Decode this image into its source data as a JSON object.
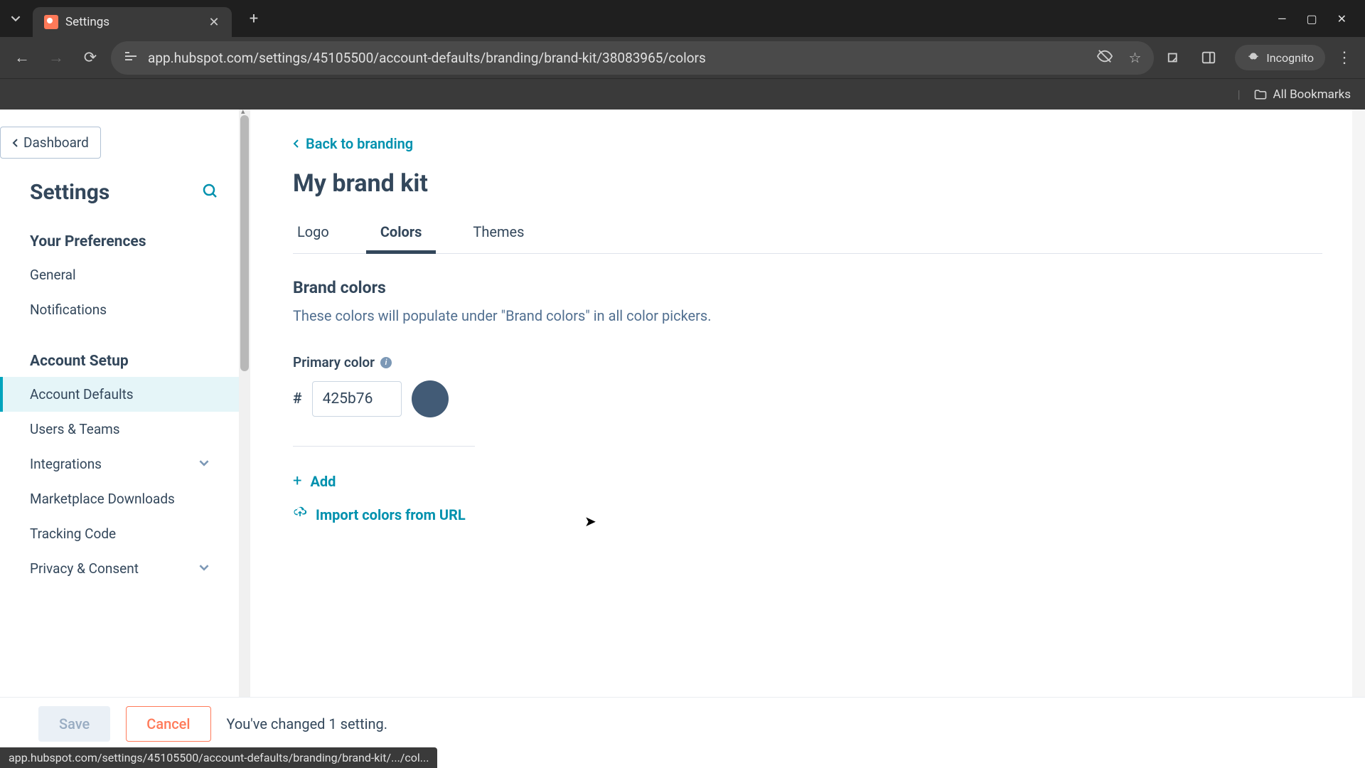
{
  "browser": {
    "tab_title": "Settings",
    "url": "app.hubspot.com/settings/45105500/account-defaults/branding/brand-kit/38083965/colors",
    "incognito_label": "Incognito",
    "bookmarks_label": "All Bookmarks",
    "status_url": "app.hubspot.com/settings/45105500/account-defaults/branding/brand-kit/.../col..."
  },
  "sidebar": {
    "dashboard": "Dashboard",
    "title": "Settings",
    "sections": {
      "prefs_label": "Your Preferences",
      "setup_label": "Account Setup"
    },
    "items": {
      "general": "General",
      "notifications": "Notifications",
      "account_defaults": "Account Defaults",
      "users_teams": "Users & Teams",
      "integrations": "Integrations",
      "marketplace": "Marketplace Downloads",
      "tracking": "Tracking Code",
      "privacy": "Privacy & Consent"
    }
  },
  "main": {
    "back": "Back to branding",
    "title": "My brand kit",
    "tabs": {
      "logo": "Logo",
      "colors": "Colors",
      "themes": "Themes"
    },
    "brand_colors": {
      "heading": "Brand colors",
      "desc": "These colors will populate under \"Brand colors\" in all color pickers.",
      "primary_label": "Primary color",
      "hash": "#",
      "primary_value": "425b76",
      "primary_hex": "#425b76"
    },
    "add": "Add",
    "import": "Import colors from URL"
  },
  "footer": {
    "save": "Save",
    "cancel": "Cancel",
    "msg": "You've changed 1 setting."
  }
}
